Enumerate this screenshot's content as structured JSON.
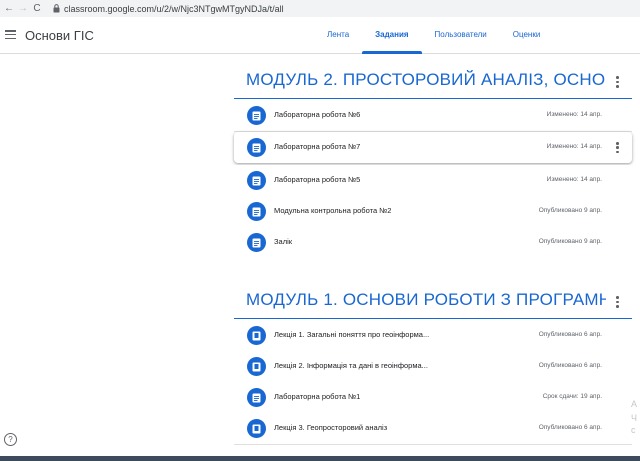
{
  "browser": {
    "back": "←",
    "forward": "→",
    "reload": "C",
    "url": "classroom.google.com/u/2/w/Njc3NTgwMTgyNDJa/t/all"
  },
  "header": {
    "title": "Основи ГІС",
    "tabs": [
      {
        "label": "Лента"
      },
      {
        "label": "Задания"
      },
      {
        "label": "Пользователи"
      },
      {
        "label": "Оценки"
      }
    ]
  },
  "help_label": "?",
  "topics": [
    {
      "title": "МОДУЛЬ 2. ПРОСТОРОВИЙ АНАЛІЗ, ОСНО...",
      "items": [
        {
          "title": "Лабораторна робота №6",
          "meta": "Изменено: 14 апр."
        },
        {
          "title": "Лабораторна робота №7",
          "meta": "Изменено: 14 апр."
        },
        {
          "title": "Лабораторна робота №5",
          "meta": "Изменено: 14 апр."
        },
        {
          "title": "Модульна контрольна робота №2",
          "meta": "Опубликовано 9 апр."
        },
        {
          "title": "Залік",
          "meta": "Опубликовано 9 апр."
        }
      ]
    },
    {
      "title": "МОДУЛЬ 1. ОСНОВИ РОБОТИ З ПРОГРАМН...",
      "items": [
        {
          "title": "Лекція 1. Загальні поняття про геоінформа...",
          "meta": "Опубликовано 6 апр."
        },
        {
          "title": "Лекція 2. Інформація та дані в геоінформа...",
          "meta": "Опубликовано 6 апр."
        },
        {
          "title": "Лабораторна робота №1",
          "meta": "Срок сдачи: 19 апр."
        },
        {
          "title": "Лекція 3. Геопросторовий аналіз",
          "meta": "Опубликовано 6 апр."
        }
      ]
    }
  ],
  "ghost_text": [
    "А",
    "Ч",
    "с"
  ],
  "colors": {
    "accent": "#1967d2",
    "text": "#202124",
    "muted": "#5f6368"
  }
}
